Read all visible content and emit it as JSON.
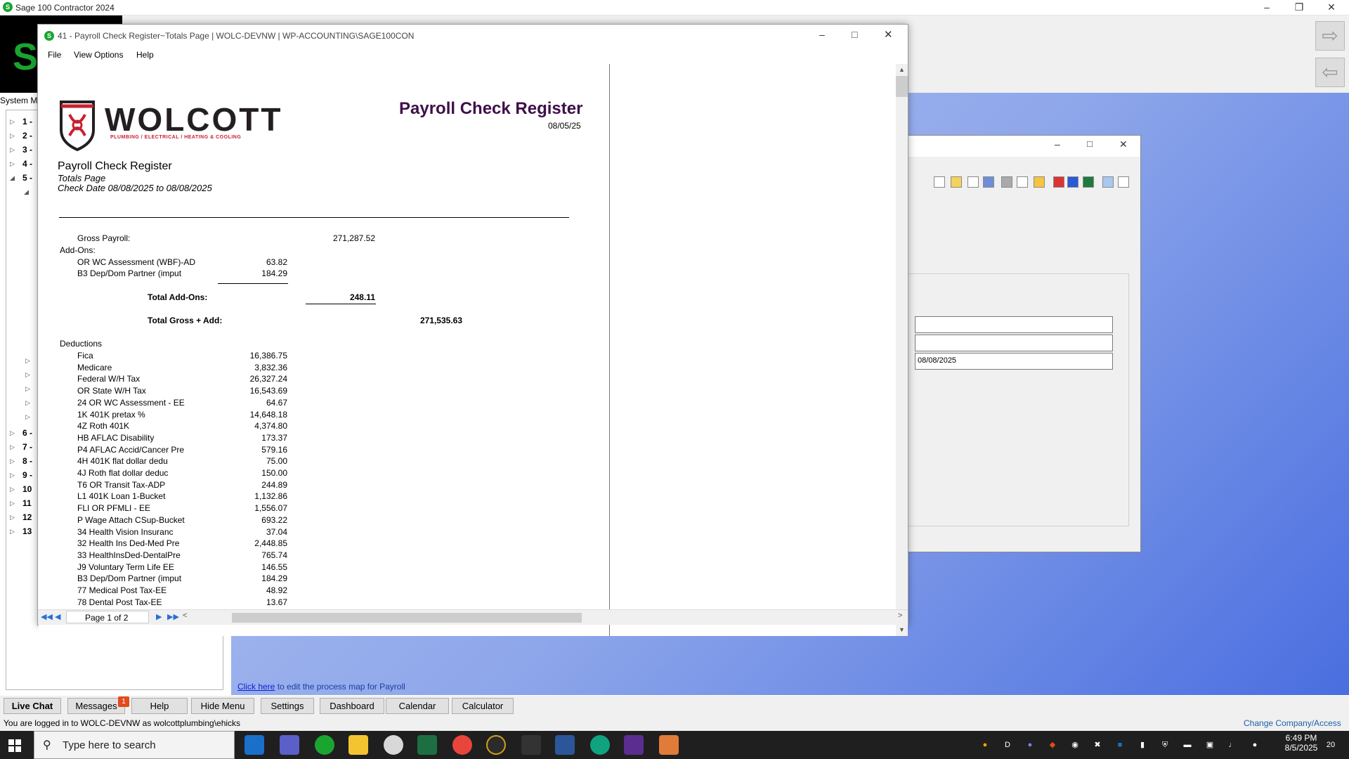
{
  "app": {
    "title": "Sage 100 Contractor 2024",
    "menu_label": "System M",
    "tree_items": [
      "1 -",
      "2 -",
      "3 -",
      "4 -",
      "5 -",
      "6 -",
      "7 -",
      "8 -",
      "9 -",
      "10",
      "11",
      "12",
      "13"
    ],
    "process_link": {
      "link_text": "Click here",
      "rest": "to edit the process map for Payroll"
    },
    "bottom_buttons": [
      "Live Chat",
      "Messages",
      "Help",
      "Hide Menu",
      "Settings",
      "Dashboard",
      "Calendar",
      "Calculator"
    ],
    "messages_badge": "1",
    "login_status": "You are logged in to WOLC-DEVNW as wolcottplumbing\\ehicks",
    "change_company": "Change Company/Access"
  },
  "background_dialog": {
    "date_value": "08/08/2025"
  },
  "report_window": {
    "title": "41 - Payroll Check Register~Totals Page  |  WOLC-DEVNW  |  WP-ACCOUNTING\\SAGE100CON",
    "menu": [
      "File",
      "View Options",
      "Help"
    ],
    "page_indicator": "Page 1 of 2"
  },
  "report": {
    "logo": {
      "name": "WOLCOTT",
      "tagline": "PLUMBING / ELECTRICAL / HEATING & COOLING"
    },
    "heading": "Payroll Check Register",
    "print_date": "08/05/25",
    "name": "Payroll Check Register",
    "subtitle": "Totals Page",
    "check_date": "Check Date 08/08/2025 to 08/08/2025",
    "gross_payroll_label": "Gross Payroll:",
    "gross_payroll_value": "271,287.52",
    "addons_label": "Add-Ons:",
    "addons": [
      {
        "label": "OR WC Assessment (WBF)-AD",
        "value": "63.82"
      },
      {
        "label": "B3 Dep/Dom Partner (imput",
        "value": "184.29"
      }
    ],
    "total_addons_label": "Total Add-Ons:",
    "total_addons_value": "248.11",
    "total_gross_label": "Total Gross + Add:",
    "total_gross_value": "271,535.63",
    "deductions_label": "Deductions",
    "deductions": [
      {
        "label": "Fica",
        "value": "16,386.75"
      },
      {
        "label": "Medicare",
        "value": "3,832.36"
      },
      {
        "label": "Federal W/H Tax",
        "value": "26,327.24"
      },
      {
        "label": "OR State W/H Tax",
        "value": "16,543.69"
      },
      {
        "label": "24 OR WC Assessment - EE",
        "value": "64.67"
      },
      {
        "label": "1K  401K pretax %",
        "value": "14,648.18"
      },
      {
        "label": "4Z Roth 401K",
        "value": "4,374.80"
      },
      {
        "label": "HB AFLAC Disability",
        "value": "173.37"
      },
      {
        "label": "P4 AFLAC Accid/Cancer Pre",
        "value": "579.16"
      },
      {
        "label": "4H  401K flat dollar dedu",
        "value": "75.00"
      },
      {
        "label": "4J Roth flat dollar deduc",
        "value": "150.00"
      },
      {
        "label": "T6 OR Transit Tax-ADP",
        "value": "244.89"
      },
      {
        "label": "L1 401K Loan 1-Bucket",
        "value": "1,132.86"
      },
      {
        "label": "FLI OR PFMLI - EE",
        "value": "1,556.07"
      },
      {
        "label": "P Wage Attach CSup-Bucket",
        "value": "693.22"
      },
      {
        "label": "34 Health Vision Insuranc",
        "value": "37.04"
      },
      {
        "label": "32 Health Ins Ded-Med Pre",
        "value": "2,448.85"
      },
      {
        "label": "33 HealthInsDed-DentalPre",
        "value": "765.74"
      },
      {
        "label": "J9 Voluntary Term Life EE",
        "value": "146.55"
      },
      {
        "label": "B3 Dep/Dom Partner (imput",
        "value": "184.29"
      },
      {
        "label": "77 Medical Post Tax-EE",
        "value": "48.92"
      },
      {
        "label": "78 Dental Post Tax-EE",
        "value": "13.67"
      }
    ]
  },
  "taskbar": {
    "search_placeholder": "Type here to search",
    "time": "6:49 PM",
    "date": "8/5/2025",
    "notification_count": "20"
  }
}
